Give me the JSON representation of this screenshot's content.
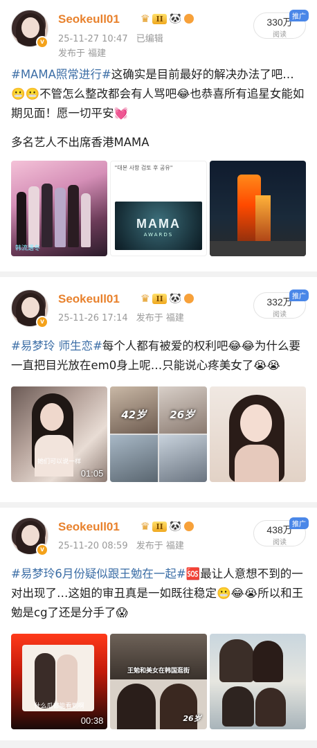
{
  "posts": [
    {
      "username": "Seokeull01",
      "level": "II",
      "time_edit": "25-11-27 10:47",
      "edited": "已编辑",
      "posted_from": "发布于 福建",
      "views": "330万",
      "views_label": "阅读",
      "promo": "推广",
      "tag": "#MAMA照常进行#",
      "body": "这确实是目前最好的解决办法了吧…😬😬不管怎么整改都会有人骂吧😂也恭喜所有追星女能如期见面！愿一切平安💓",
      "extra": "多名艺人不出席香港MAMA",
      "images": [
        {
          "caption": "韩流遇冬",
          "duration": ""
        },
        {
          "caption": "\"대본 사항 검토 후 공유\"",
          "duration": ""
        },
        {
          "caption": "",
          "duration": ""
        }
      ],
      "mama_logo": "MAMA",
      "mama_sub": "AWARDS"
    },
    {
      "username": "Seokeull01",
      "level": "II",
      "time_edit": "25-11-26 17:14",
      "edited": "",
      "posted_from": "发布于 福建",
      "views": "332万",
      "views_label": "阅读",
      "promo": "推广",
      "tag": "#易梦玲 师生恋#",
      "body": "每个人都有被爱的权利吧😂😂为什么要一直把目光放在em0身上呢…只能说心疼美女了😭😭",
      "extra": "",
      "images": [
        {
          "caption": "她们可以说一样",
          "duration": "01:05"
        },
        {
          "caption": "",
          "duration": ""
        },
        {
          "caption": "",
          "duration": ""
        }
      ],
      "age_left": "42岁",
      "age_right": "26岁"
    },
    {
      "username": "Seokeull01",
      "level": "II",
      "time_edit": "25-11-20 08:59",
      "edited": "",
      "posted_from": "发布于 福建",
      "views": "438万",
      "views_label": "阅读",
      "promo": "推广",
      "tag": "#易梦玲6月份疑似跟王勉在一起#",
      "body": "🆘最让人意想不到的一对出现了…这姐的审丑真是一如既往稳定😬😂😭所以和王勉是cg了还是分手了😱",
      "extra": "",
      "images": [
        {
          "caption": "什么瓜都能看到啊",
          "duration": "00:38"
        },
        {
          "caption": "王勉和美女在韩国逛街",
          "duration": ""
        },
        {
          "caption": "",
          "duration": ""
        }
      ],
      "age_right": "26岁"
    }
  ],
  "colors": {
    "username": "#e8812c",
    "tag": "#3c6ea6",
    "promo": "#4a87e8"
  }
}
